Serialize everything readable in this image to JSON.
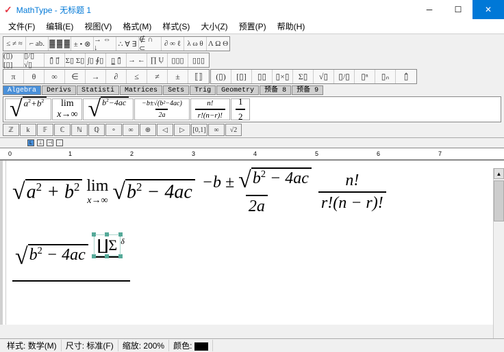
{
  "title": "MathType - 无标题 1",
  "menu": [
    "文件(F)",
    "编辑(E)",
    "视图(V)",
    "格式(M)",
    "样式(S)",
    "大小(Z)",
    "预置(P)",
    "帮助(H)"
  ],
  "palette_row1": [
    [
      "≤ ≠ ≈",
      "⌐ ab.",
      "▓ ▓ ▓",
      "± • ⊗",
      "→ ⇔ ↓",
      "∴ ∀ ∃",
      "∉ ∩ ⊂",
      "∂ ∞ ℓ",
      "λ ω θ",
      "Λ Ω Θ"
    ]
  ],
  "palette_row2": [
    [
      "(▯) [▯]",
      "▯/▯ √▯",
      "▯̄ ▯⃗",
      "Σ▯ Σ▯",
      "∫▯ ∮▯",
      "▯̲ ▯̄",
      "→ ←",
      "∏ Ụ",
      "▯▯▯",
      "▯▯▯"
    ]
  ],
  "palette_row3": [
    [
      "π",
      "θ",
      "∞",
      "∈",
      "→",
      "∂",
      "≤",
      "≠",
      "±",
      "⟦⟧",
      "(▯)",
      "[▯]",
      "▯▯",
      "▯×▯",
      "Σ▯",
      "√▯",
      "▯/▯",
      "▯ⁿ",
      "▯ₙ",
      "▯̂"
    ]
  ],
  "tabs": [
    "Algebra",
    "Derivs",
    "Statisti",
    "Matrices",
    "Sets",
    "Trig",
    "Geometry",
    "预备 8",
    "预备 9"
  ],
  "active_tab": "Algebra",
  "templates": [
    "√(a²+b²)",
    "lim x→∞",
    "√(b²−4ac)",
    "(−b±√(b²−4ac))/2a",
    "n!/(r!(n−r)!)",
    "1/2"
  ],
  "row5": [
    "ℤ",
    "k",
    "𝔽",
    "ℂ",
    "ℕ",
    "ℚ",
    "∘",
    "∞",
    "⊕",
    "◁",
    "▷",
    "[0,1]",
    "∞",
    "√2"
  ],
  "ruler": {
    "marks": [
      "0",
      "1",
      "2",
      "3",
      "4",
      "5",
      "6",
      "7"
    ]
  },
  "status": {
    "style_label": "样式:",
    "style_value": "数学(M)",
    "size_label": "尺寸:",
    "size_value": "标准(F)",
    "zoom_label": "缩放:",
    "zoom_value": "200%",
    "color_label": "颜色:"
  },
  "formula1": {
    "sqrt1": "a² + b²",
    "lim_top": "lim",
    "lim_bot": "x→∞",
    "sqrt2": "b² − 4ac",
    "frac1_top_a": "−b ±",
    "frac1_top_b": "b² − 4ac",
    "frac1_bot": "2a",
    "frac2_top": "n!",
    "frac2_bot": "r!(n − r)!"
  },
  "formula2": {
    "sqrt_num": "b² − 4ac",
    "frac_num": "∐Σ",
    "frac_num_sup": "δ"
  }
}
